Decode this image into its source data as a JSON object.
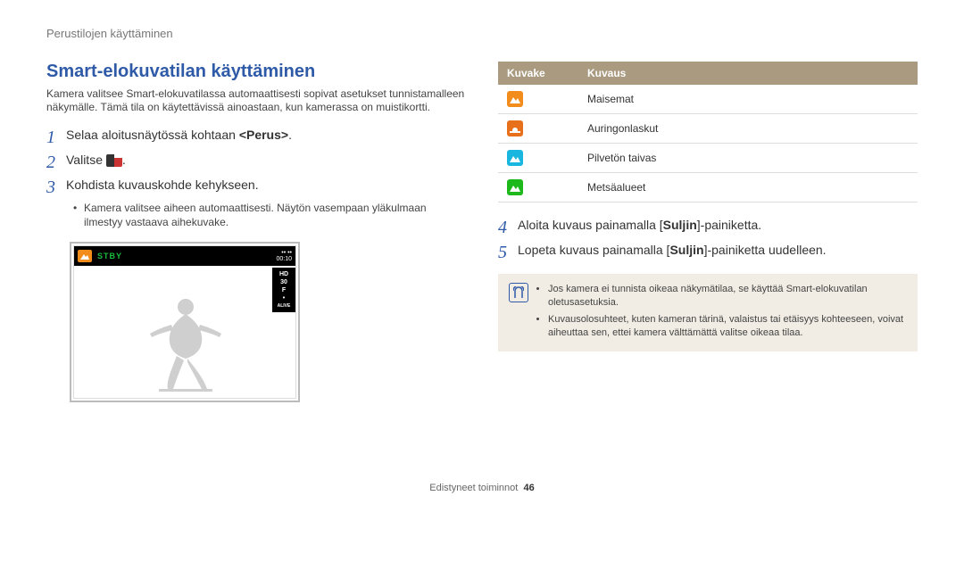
{
  "running_head": "Perustilojen käyttäminen",
  "section_title": "Smart-elokuvatilan käyttäminen",
  "intro": "Kamera valitsee Smart-elokuvatilassa automaattisesti sopivat asetukset tunnistamalleen näkymälle. Tämä tila on käytettävissä ainoastaan, kun kamerassa on muistikortti.",
  "steps_left": [
    {
      "n": "1",
      "pre": "Selaa aloitusnäytössä kohtaan ",
      "strong": "<Perus>",
      "post": "."
    },
    {
      "n": "2",
      "pre": "Valitse ",
      "icon": true,
      "post": "."
    },
    {
      "n": "3",
      "pre": "Kohdista kuvauskohde kehykseen.",
      "strong": "",
      "post": ""
    }
  ],
  "left_bullet": "Kamera valitsee aiheen automaattisesti. Näytön vasempaan yläkulmaan ilmestyy vastaava aihekuvake.",
  "screen": {
    "stby": "STBY",
    "time": "00:10",
    "side": [
      "HD",
      "30",
      "F",
      "•",
      "ALIVE"
    ]
  },
  "table": {
    "col1": "Kuvake",
    "col2": "Kuvaus",
    "rows": [
      {
        "icon": "landscape",
        "color": "ic-orange",
        "label": "Maisemat"
      },
      {
        "icon": "sunset",
        "color": "ic-darkorange",
        "label": "Auringonlaskut"
      },
      {
        "icon": "sky",
        "color": "ic-cyan",
        "label": "Pilvetön taivas"
      },
      {
        "icon": "forest",
        "color": "ic-green",
        "label": "Metsäalueet"
      }
    ]
  },
  "steps_right": [
    {
      "n": "4",
      "pre": "Aloita kuvaus painamalla [",
      "strong": "Suljin",
      "post": "]-painiketta."
    },
    {
      "n": "5",
      "pre": "Lopeta kuvaus painamalla [",
      "strong": "Suljin",
      "post": "]-painiketta uudelleen."
    }
  ],
  "notes": [
    "Jos kamera ei tunnista oikeaa näkymätilaa, se käyttää Smart-elokuvatilan oletusasetuksia.",
    "Kuvausolosuhteet, kuten kameran tärinä, valaistus tai etäisyys kohteeseen, voivat aiheuttaa sen, ettei kamera välttämättä valitse oikeaa tilaa."
  ],
  "footer": {
    "label": "Edistyneet toiminnot",
    "page": "46"
  }
}
